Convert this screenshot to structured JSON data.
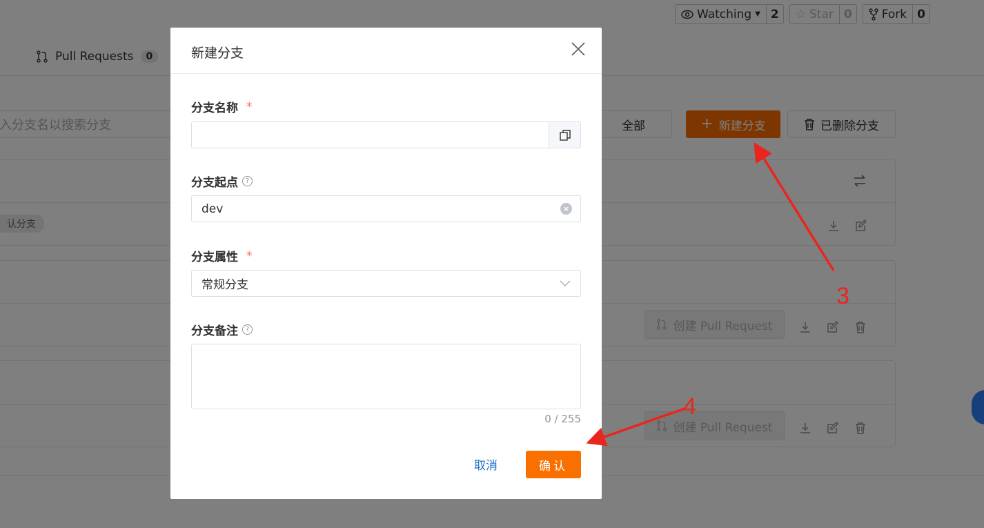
{
  "repo_actions": {
    "watching": {
      "label": "Watching",
      "count": "2"
    },
    "star": {
      "label": "Star",
      "count": "0"
    },
    "fork": {
      "label": "Fork",
      "count": "0"
    }
  },
  "tabs": {
    "pull_requests": {
      "label": "Pull Requests",
      "count": "0"
    }
  },
  "toolbar": {
    "search_placeholder": "入分支名以搜索分支",
    "filter_all": "全部",
    "new_branch": "新建分支",
    "deleted_branches": "已删除分支"
  },
  "branch_list": {
    "default_tag": "认分支",
    "create_pr_label": "创建 Pull Request"
  },
  "dialog": {
    "title": "新建分支",
    "fields": {
      "name": {
        "label": "分支名称",
        "required_mark": "*",
        "value": ""
      },
      "origin": {
        "label": "分支起点",
        "value": "dev"
      },
      "attribute": {
        "label": "分支属性",
        "required_mark": "*",
        "value": "常规分支"
      },
      "note": {
        "label": "分支备注",
        "counter": "0 / 255"
      }
    },
    "cancel": "取消",
    "confirm": "确认"
  },
  "annotations": {
    "step3": "3",
    "step4": "4"
  },
  "colors": {
    "primary_orange": "#fa6c00",
    "annotation_red": "#e8261f",
    "link_blue": "#1e6fcf"
  }
}
